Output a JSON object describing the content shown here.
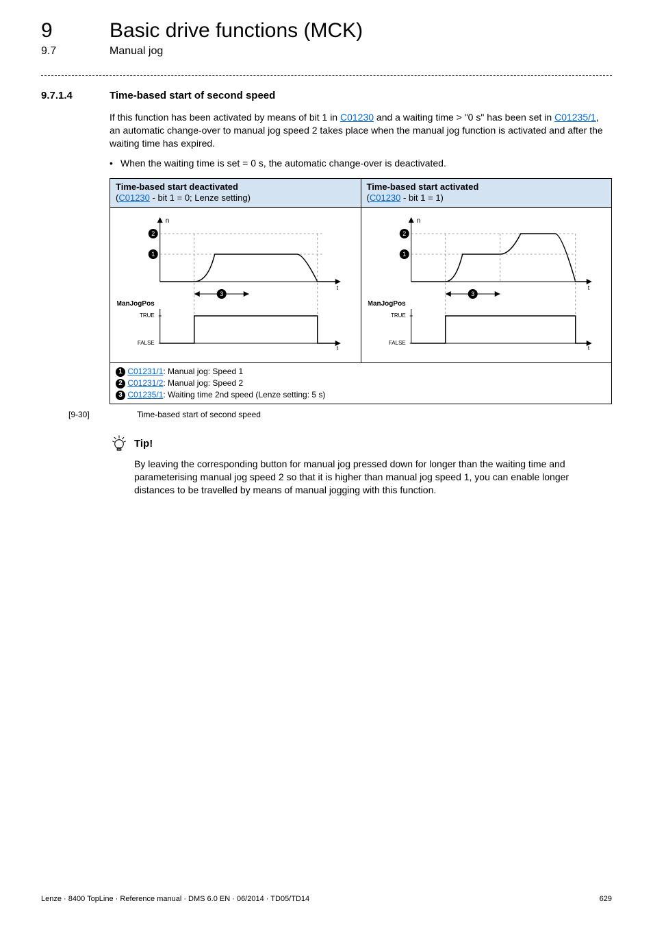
{
  "header": {
    "chapter_num": "9",
    "chapter_title": "Basic drive functions (MCK)",
    "section_num": "9.7",
    "section_title": "Manual jog"
  },
  "subsection": {
    "num": "9.7.1.4",
    "title": "Time-based start of second speed"
  },
  "para1_a": "If this function has been activated by means of bit 1 in ",
  "para1_link1": "C01230",
  "para1_b": " and a waiting time > \"0 s\" has been set in ",
  "para1_link2": "C01235/1",
  "para1_c": ", an automatic change-over to manual jog speed 2 takes place when the manual jog function is activated and after the waiting time has expired.",
  "bullet1": "When the waiting time is set = 0 s, the automatic change-over is deactivated.",
  "fig": {
    "left_header_strong": "Time-based start deactivated",
    "left_header_sub_a": "(",
    "left_header_sub_link": "C01230",
    "left_header_sub_b": " - bit 1 = 0; Lenze setting)",
    "right_header_strong": "Time-based start activated",
    "right_header_sub_a": "(",
    "right_header_sub_link": "C01230",
    "right_header_sub_b": " - bit 1 = 1)",
    "legend": {
      "l1_link": "C01231/1",
      "l1_text": ": Manual jog: Speed 1",
      "l2_link": "C01231/2",
      "l2_text": ": Manual jog: Speed 2",
      "l3_link": "C01235/1",
      "l3_text": ": Waiting time 2nd speed (Lenze setting: 5 s)"
    },
    "axis": {
      "n": "n",
      "t": "t",
      "manjogpos": "ManJogPos",
      "true": "TRUE",
      "false": "FALSE"
    },
    "caption_num": "[9-30]",
    "caption_text": "Time-based start of second speed"
  },
  "tip": {
    "label": "Tip!",
    "body": "By leaving the corresponding button for manual jog pressed down for longer than the waiting time and parameterising manual jog speed 2 so that it is higher than manual jog speed 1, you can enable longer distances to be travelled by means of manual jogging with this function."
  },
  "footer": {
    "left": "Lenze · 8400 TopLine · Reference manual · DMS 6.0 EN · 06/2014 · TD05/TD14",
    "right": "629"
  },
  "chart_data": [
    {
      "type": "line",
      "title": "Time-based start deactivated",
      "variant": "bit1_0",
      "speed_curve": {
        "x": [
          0,
          2,
          10,
          12
        ],
        "y": [
          0,
          1,
          1,
          0
        ],
        "ylevels": {
          "0": 0,
          "1": "speed1",
          "2": "speed2"
        }
      },
      "manjogpos": {
        "x": [
          0,
          2,
          2,
          12,
          12,
          14
        ],
        "y": [
          "FALSE",
          "FALSE",
          "TRUE",
          "TRUE",
          "FALSE",
          "FALSE"
        ]
      },
      "waiting_time_marker": {
        "from": 2,
        "to": 6,
        "label": "3"
      }
    },
    {
      "type": "line",
      "title": "Time-based start activated",
      "variant": "bit1_1",
      "speed_curve": {
        "x": [
          0,
          2,
          6,
          8,
          10,
          12
        ],
        "y": [
          0,
          1,
          1,
          2,
          2,
          0
        ],
        "ylevels": {
          "0": 0,
          "1": "speed1",
          "2": "speed2"
        }
      },
      "manjogpos": {
        "x": [
          0,
          2,
          2,
          12,
          12,
          14
        ],
        "y": [
          "FALSE",
          "FALSE",
          "TRUE",
          "TRUE",
          "FALSE",
          "FALSE"
        ]
      },
      "waiting_time_marker": {
        "from": 2,
        "to": 6,
        "label": "3"
      }
    }
  ]
}
